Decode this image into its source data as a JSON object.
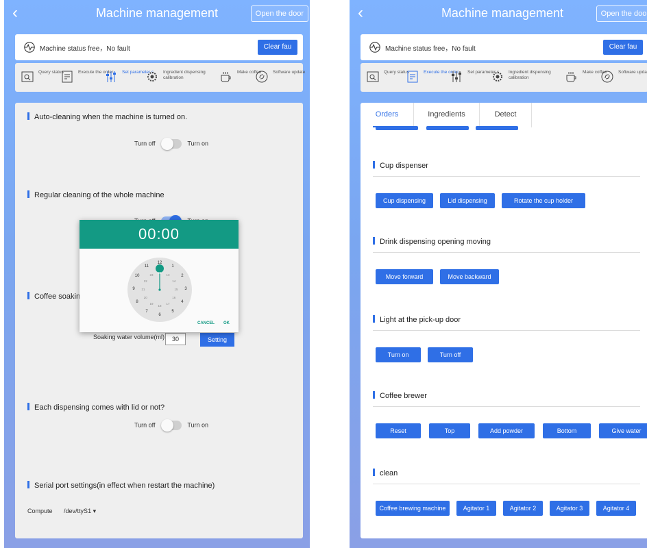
{
  "header": {
    "title": "Machine management",
    "open_door": "Open the door"
  },
  "status": {
    "text": "Machine status free，No fault",
    "clear": "Clear fau"
  },
  "toolbar": [
    {
      "label": "Query status",
      "icon": "query-icon"
    },
    {
      "label": "Execute the order",
      "icon": "order-icon"
    },
    {
      "label": "Set parameter s",
      "icon": "sliders-icon"
    },
    {
      "label": "Ingredient dispensing calibration",
      "icon": "calibration-icon"
    },
    {
      "label": "Make coffee",
      "icon": "coffee-cup-icon"
    },
    {
      "label": "Software update",
      "icon": "update-icon"
    }
  ],
  "left": {
    "auto_clean": {
      "title": "Auto-cleaning when the machine is turned on.",
      "off": "Turn off",
      "on": "Turn on"
    },
    "regular_clean": {
      "title": "Regular cleaning of the whole machine",
      "off": "Turn off",
      "on": "Turn on"
    },
    "coffee_soak": {
      "title": "Coffee soaking",
      "volume_label": "Soaking water volume(ml)",
      "volume_value": "30",
      "setting": "Setting"
    },
    "time_dialog": {
      "time": "00:00",
      "cancel": "CANCEL",
      "ok": "OK",
      "outer": [
        "12",
        "1",
        "2",
        "3",
        "4",
        "5",
        "6",
        "7",
        "8",
        "9",
        "10",
        "11"
      ],
      "inner": [
        "00",
        "13",
        "14",
        "15",
        "16",
        "17",
        "18",
        "19",
        "20",
        "21",
        "22",
        "23"
      ]
    },
    "lid": {
      "title": "Each dispensing comes with lid or not?",
      "off": "Turn off",
      "on": "Turn on"
    },
    "serial": {
      "title": "Serial port settings(in effect when restart the machine)",
      "label": "Compute",
      "value": "/dev/ttyS1 ▾"
    }
  },
  "right": {
    "tabs": [
      "Orders",
      "Ingredients",
      "Detect"
    ],
    "sections": [
      {
        "title": "Cup dispenser",
        "buttons": [
          "Cup dispensing",
          "Lid dispensing",
          "Rotate the cup holder"
        ]
      },
      {
        "title": "Drink dispensing opening moving",
        "buttons": [
          "Move forward",
          "Move backward"
        ]
      },
      {
        "title": "Light at the pick-up door",
        "buttons": [
          "Turn on",
          "Turn off"
        ]
      },
      {
        "title": "Coffee brewer",
        "buttons": [
          "Reset",
          "Top",
          "Add powder",
          "Bottom",
          "Give water"
        ]
      },
      {
        "title": "clean",
        "buttons": [
          "Coffee brewing machine",
          "Agitator 1",
          "Agitator 2",
          "Agitator 3",
          "Agitator 4"
        ]
      }
    ]
  },
  "colors": {
    "accent": "#2f6fe6",
    "dialog": "#139a84"
  }
}
